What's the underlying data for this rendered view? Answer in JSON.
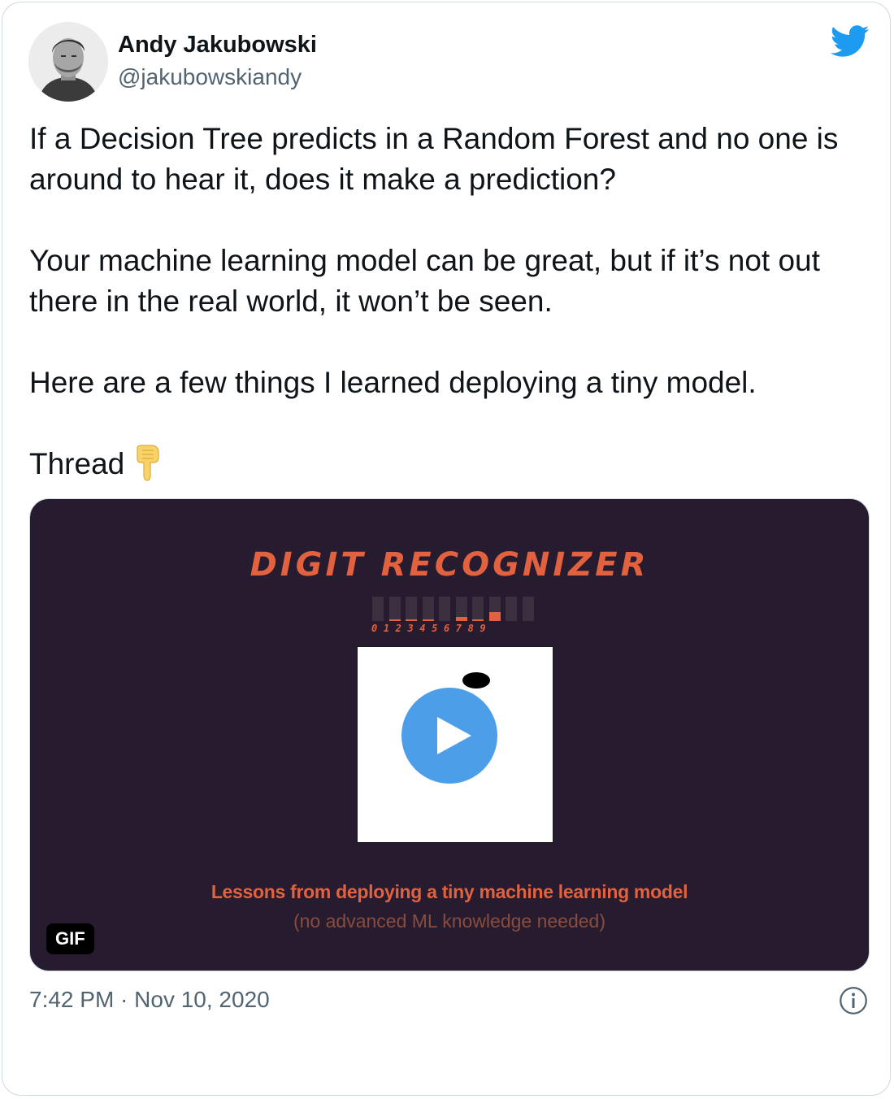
{
  "author": {
    "name": "Andy Jakubowski",
    "handle": "@jakubowskiandy",
    "avatar_icon": "profile-photo"
  },
  "tweet": {
    "paragraphs": [
      "If a Decision Tree predicts in a Random Forest and no one is around to hear it, does it make a prediction?",
      "Your machine learning model can be great, but if it’s not out there in the real world, it won’t be seen.",
      "Here are a few things I learned deploying a tiny model."
    ],
    "thread_label": "Thread",
    "emoji": "backhand-index-pointing-down"
  },
  "media": {
    "title": "DIGIT RECOGNIZER",
    "digit_labels": "0123456789",
    "digit_levels": [
      0,
      0.05,
      0.08,
      0.02,
      0,
      0.15,
      0.05,
      0.38,
      0,
      0
    ],
    "subtitle": "Lessons from deploying a tiny machine learning model",
    "subtitle2": "(no advanced ML knowledge needed)",
    "badge": "GIF",
    "play_icon": "play-icon"
  },
  "footer": {
    "timestamp": "7:42 PM · Nov 10, 2020",
    "info_icon": "info-icon"
  },
  "colors": {
    "twitter_blue": "#1d9bf0",
    "play_blue": "#4c9ee8",
    "gif_background": "#261b2f",
    "accent_orange": "#e2623f"
  }
}
